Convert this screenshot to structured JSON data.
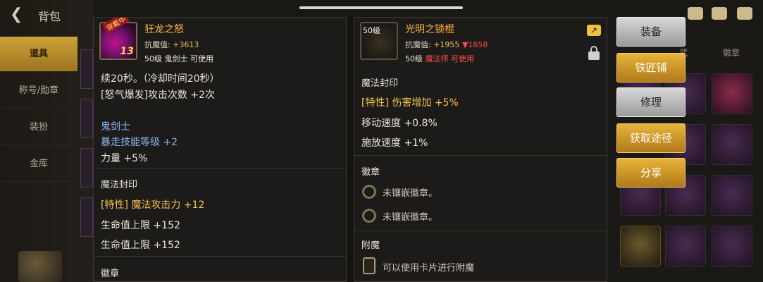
{
  "background": {
    "title": "背包",
    "tabs": [
      "道具",
      "称号/勋章",
      "装扮",
      "金库"
    ],
    "right_header": [
      "武",
      "徽章"
    ]
  },
  "left_item": {
    "name": "狂龙之怒",
    "stamp": "穿戴中",
    "enhance": "13",
    "resist_label": "抗魔值:",
    "resist_value": "+3613",
    "requirement": "50级 鬼剑士 可使用",
    "lines": {
      "l1": "续20秒。（冷却时间20秒）",
      "l2": "[怒气爆发]攻击次数 +2次",
      "class": "鬼剑士",
      "skill": "暴走技能等级 +2",
      "str": "力量 +5%"
    },
    "seal_title": "魔法封印",
    "seal_lines": [
      "[特性] 魔法攻击力 +12",
      "生命值上限 +152",
      "生命值上限 +152"
    ],
    "emblem_title": "徽章"
  },
  "right_item": {
    "level_badge": "50级",
    "name": "光明之锁棍",
    "resist_label": "抗魔值:",
    "resist_value": "+1955",
    "resist_down": "▼1658",
    "req_level": "50级",
    "req_class": "魔法师 可使用",
    "seal_title": "魔法封印",
    "seal_lines": [
      "[特性] 伤害增加 +5%",
      "移动速度 +0.8%",
      "施放速度 +1%"
    ],
    "emblem_title": "徽章",
    "emblems": [
      "未镶嵌徽章。",
      "未镶嵌徽章。"
    ],
    "enchant_title": "附魔",
    "enchant_text": "可以使用卡片进行附魔"
  },
  "buttons": {
    "equip": "装备",
    "blacksmith": "铁匠铺",
    "repair": "修理",
    "acquire": "获取途径",
    "share": "分享"
  }
}
